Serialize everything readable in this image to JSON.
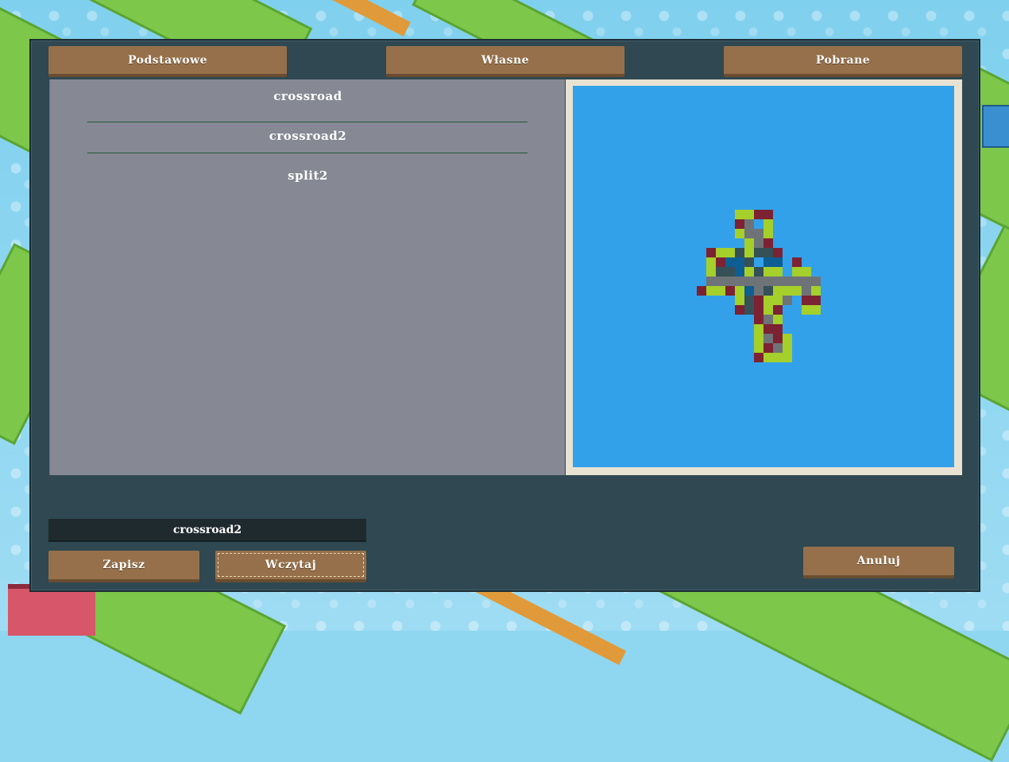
{
  "tabs": [
    {
      "label": "Podstawowe"
    },
    {
      "label": "Własne"
    },
    {
      "label": "Pobrane"
    }
  ],
  "list": {
    "items": [
      "crossroad",
      "crossroad2",
      "split2"
    ],
    "selected": "crossroad2"
  },
  "name_field": {
    "value": "crossroad2"
  },
  "buttons": {
    "save": "Zapisz",
    "load": "Wczytaj",
    "cancel": "Anuluj"
  },
  "preview": {
    "colors": {
      "background": "#33a1ea",
      "grass": "#a5cf2a",
      "road": "#6e7378",
      "building": "#7d2232",
      "water": "#0d5e93",
      "dark": "#355057"
    },
    "grid": [
      "...............",
      "....ggRb.......",
      "....Br.g.......",
      "....grrg.......",
      ".....grb.......",
      ".Bggwgwwb......",
      ".gBWWw.WW.b....",
      ".gdwWgwgg.gg...",
      ".rrrrrrrrrrrr..",
      "BggBgWrwgggrg..",
      "....gwbggr.BB..",
      "....BdbgB..gg..",
      "......Brg......",
      "......gBB......",
      "......grBg.....",
      "......gRrg.....",
      "......Bggg....."
    ]
  }
}
